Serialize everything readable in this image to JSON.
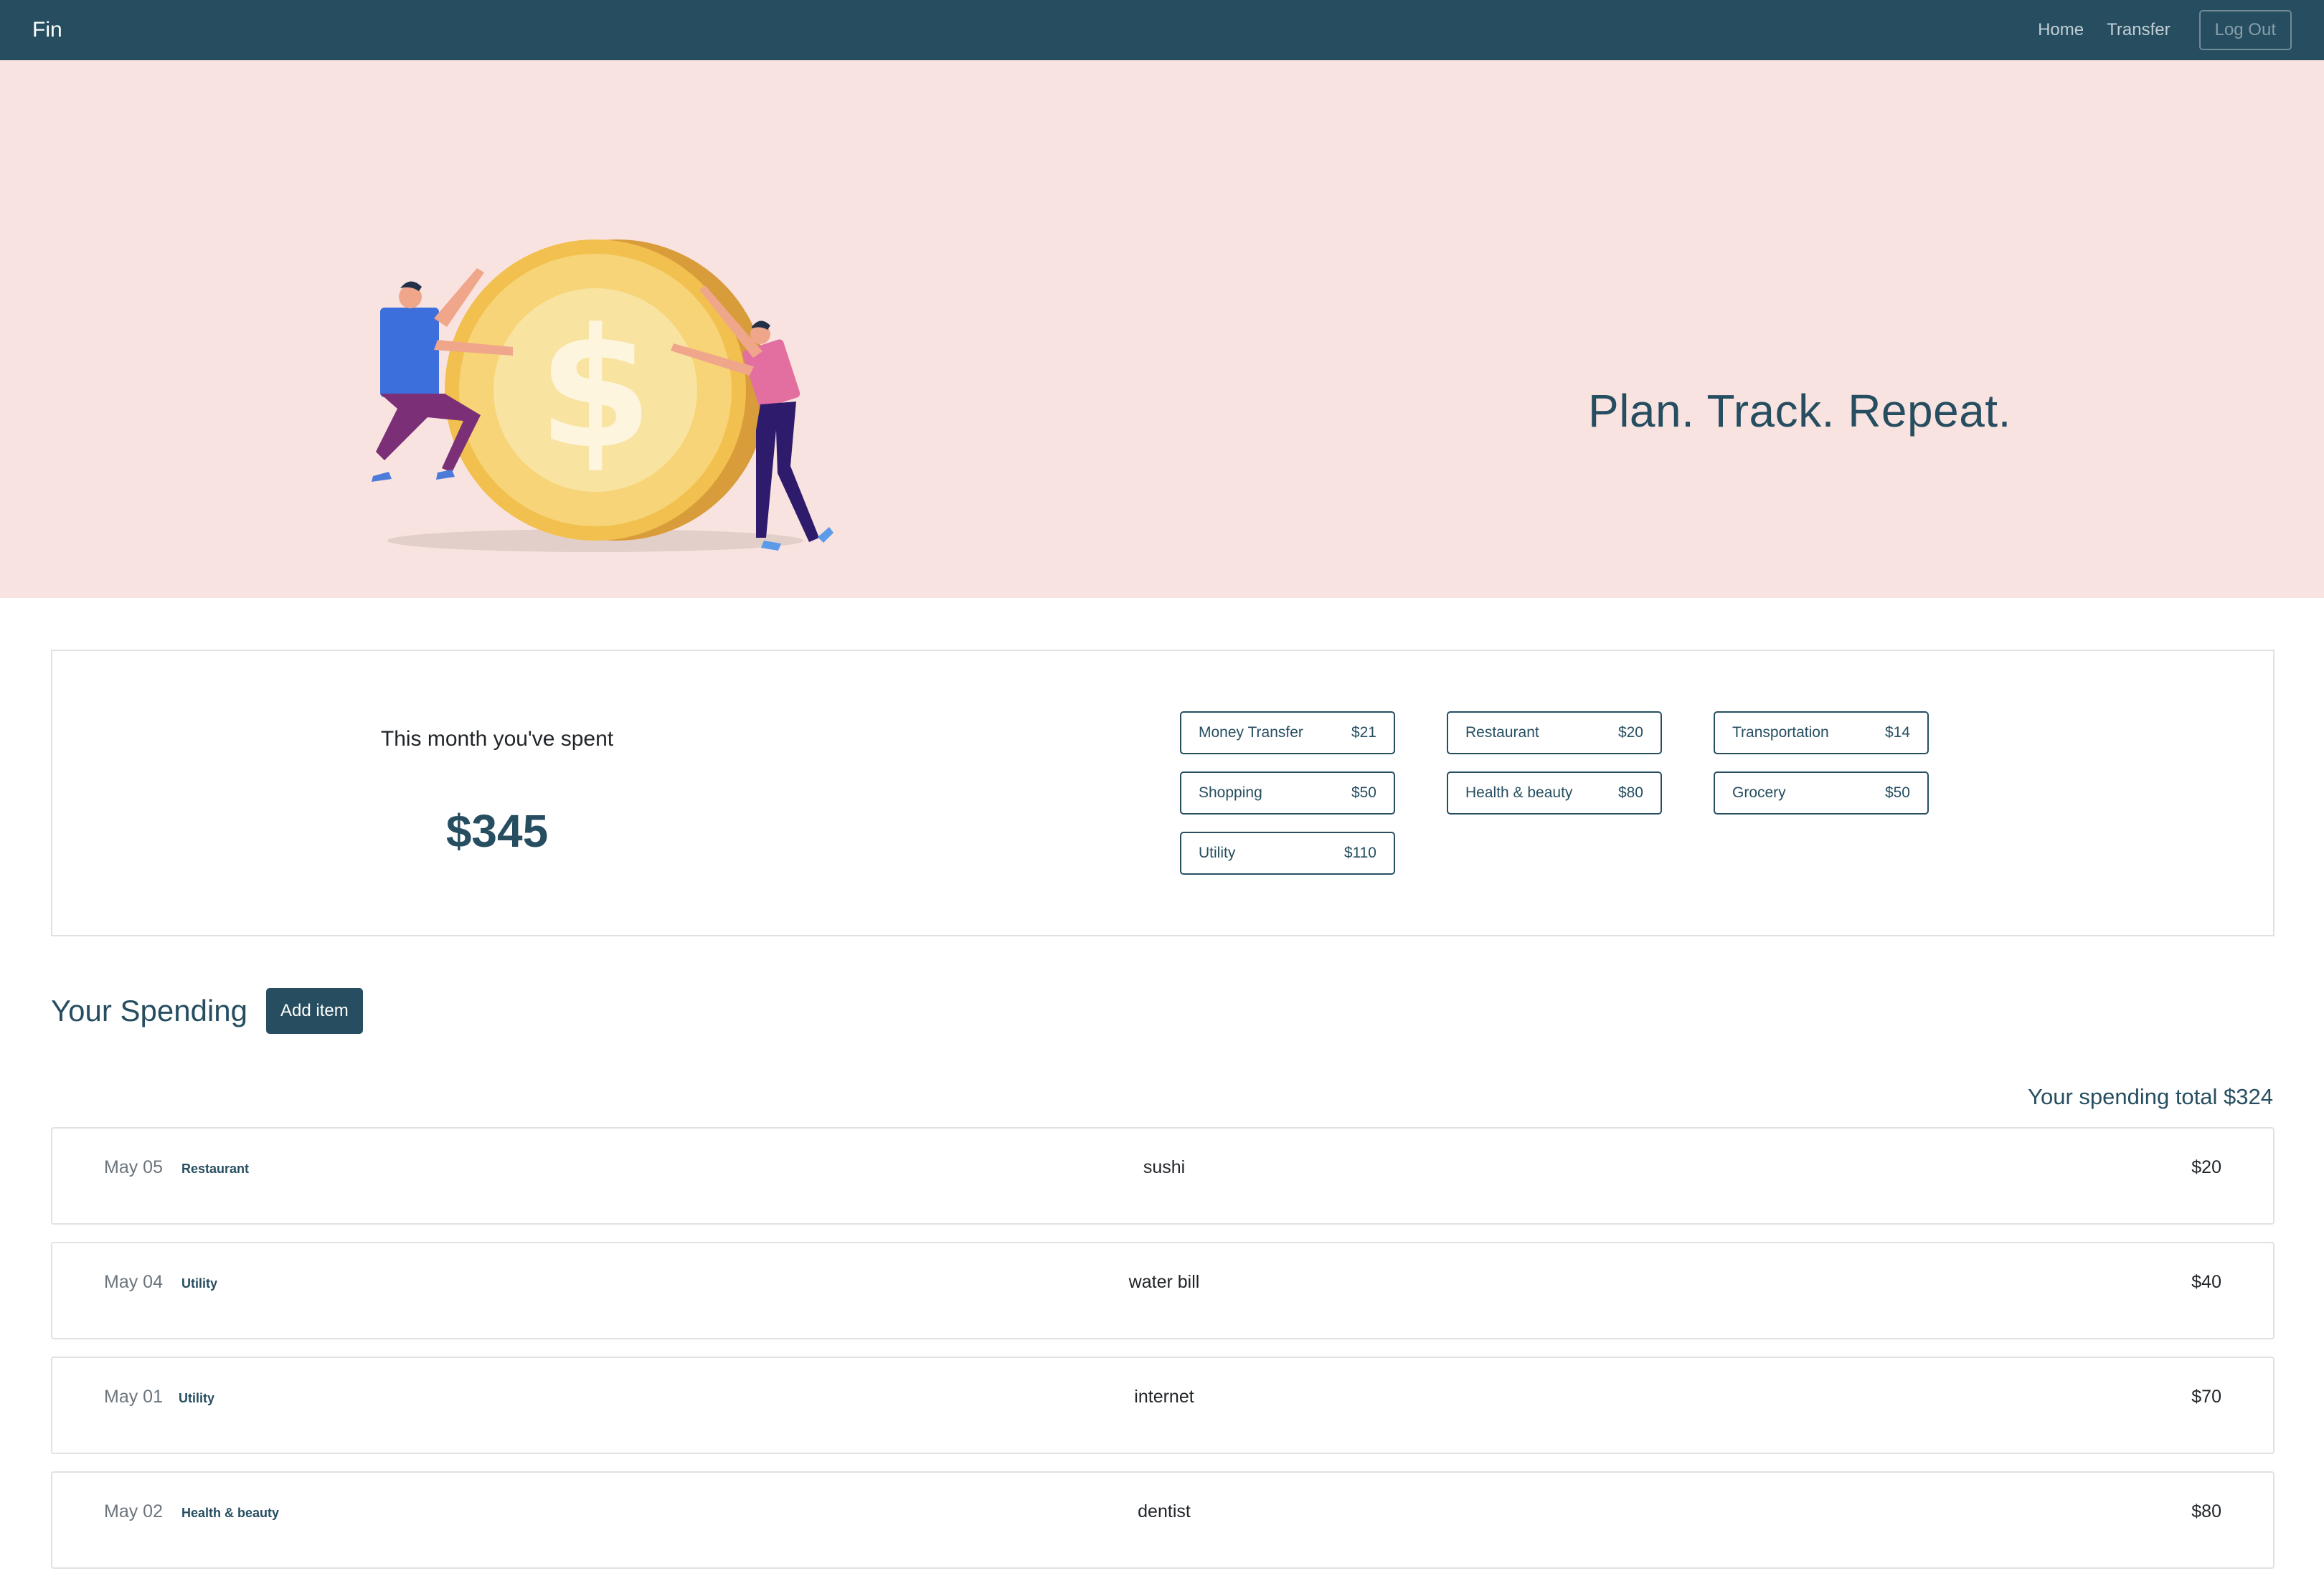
{
  "navbar": {
    "brand": "Fin",
    "links": [
      "Home",
      "Transfer"
    ],
    "logout_label": "Log Out"
  },
  "hero": {
    "tagline": "Plan. Track. Repeat.",
    "illustration": "two-people-pushing-coin-icon"
  },
  "summary": {
    "label": "This month you've spent",
    "amount": "$345",
    "categories": [
      {
        "name": "Money Transfer",
        "amount": "$21"
      },
      {
        "name": "Restaurant",
        "amount": "$20"
      },
      {
        "name": "Transportation",
        "amount": "$14"
      },
      {
        "name": "Shopping",
        "amount": "$50"
      },
      {
        "name": "Health & beauty",
        "amount": "$80"
      },
      {
        "name": "Grocery",
        "amount": "$50"
      },
      {
        "name": "Utility",
        "amount": "$110"
      }
    ]
  },
  "spending": {
    "title": "Your Spending",
    "add_label": "Add item",
    "total_text": "Your spending total $324",
    "items": [
      {
        "date": "May 05",
        "category": "Restaurant",
        "description": "sushi",
        "amount": "$20"
      },
      {
        "date": "May 04",
        "category": "Utility",
        "description": "water bill",
        "amount": "$40"
      },
      {
        "date": "May 01",
        "category": "Utility",
        "description": "internet",
        "amount": "$70"
      },
      {
        "date": "May 02",
        "category": "Health & beauty",
        "description": "dentist",
        "amount": "$80"
      }
    ]
  },
  "colors": {
    "primary": "#264e60",
    "hero_bg": "#f9e3e0",
    "coin": "#f2c04f",
    "person_left_shirt": "#3c6fdc",
    "person_right_shirt": "#e26fa0"
  }
}
